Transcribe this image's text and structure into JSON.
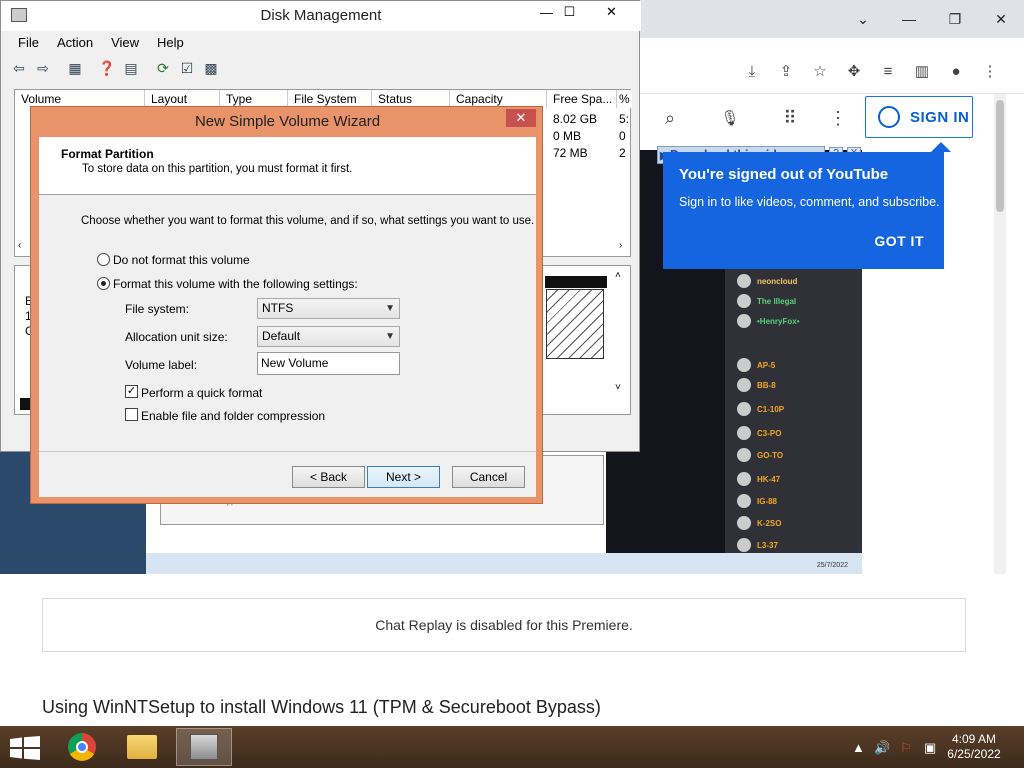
{
  "chrome": {
    "signin_label": "SIGN IN",
    "popup_title": "You're signed out of YouTube",
    "popup_text": "Sign in to like videos, comment, and subscribe.",
    "popup_button": "GOT IT",
    "download_link": "Download this video",
    "download_help": "?",
    "download_close": "X",
    "chat_replay": "Chat Replay is disabled for this Premiere.",
    "article_title": "Using WinNTSetup to install Windows 11 (TPM & Secureboot Bypass)",
    "video_discord": [
      {
        "name": "neoncloud"
      },
      {
        "name": "The Illegal"
      },
      {
        "name": "•HenryFox•"
      },
      {
        "name": "AP-5"
      },
      {
        "name": "BB-8"
      },
      {
        "name": "C1-10P"
      },
      {
        "name": "C3-PO"
      },
      {
        "name": "GO-TO"
      },
      {
        "name": "HK-47"
      },
      {
        "name": "IG-88"
      },
      {
        "name": "K-2SO"
      },
      {
        "name": "L3-37"
      }
    ],
    "video_date": "25/7/2022"
  },
  "disk_management": {
    "title": "Disk Management",
    "menu": [
      "File",
      "Action",
      "View",
      "Help"
    ],
    "columns": [
      "Volume",
      "Layout",
      "Type",
      "File System",
      "Status",
      "Capacity",
      "Free Spa...",
      "%"
    ],
    "rows": [
      {
        "free": "8.02 GB",
        "pct": "5:"
      },
      {
        "free": "0 MB",
        "pct": "0"
      },
      {
        "free": "72 MB",
        "pct": "2"
      }
    ],
    "lower_labels": [
      "B",
      "1:",
      "O"
    ]
  },
  "wizard": {
    "title": "New Simple Volume Wizard",
    "close": "✕",
    "header_title": "Format Partition",
    "header_sub": "To store data on this partition, you must format it first.",
    "instruction": "Choose whether you want to format this volume, and if so, what settings you want to use.",
    "radio_no_format": "Do not format this volume",
    "radio_format": "Format this volume with the following settings:",
    "fs_label": "File system:",
    "fs_value": "NTFS",
    "alloc_label": "Allocation unit size:",
    "alloc_value": "Default",
    "vol_label": "Volume label:",
    "vol_value": "New Volume",
    "quick_format": "Perform a quick format",
    "compression": "Enable file and folder compression",
    "back": "< Back",
    "next": "Next >",
    "cancel": "Cancel"
  },
  "taskbar": {
    "time": "4:09 AM",
    "date": "6/25/2022"
  }
}
